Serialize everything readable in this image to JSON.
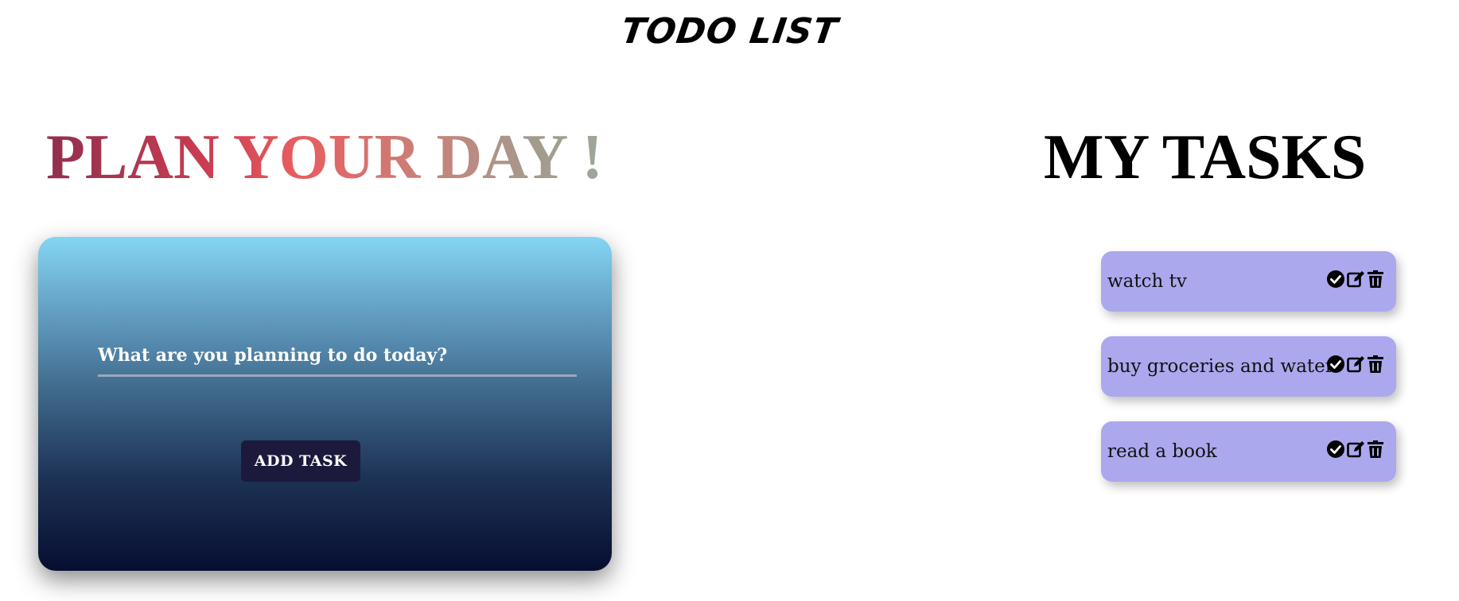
{
  "app": {
    "title": "TODO LIST"
  },
  "planner": {
    "heading": "PLAN YOUR DAY !",
    "input_placeholder": "What are you planning to do today?",
    "add_button_label": "ADD TASK"
  },
  "tasks": {
    "heading": "MY TASKS",
    "items": [
      {
        "text": "watch tv"
      },
      {
        "text": "buy groceries and water"
      },
      {
        "text": "read a book"
      }
    ],
    "action_icons": [
      "check-circle-icon",
      "edit-icon",
      "trash-icon"
    ]
  },
  "colors": {
    "task_background": "#aba8ee",
    "button_background": "#1b1a3c",
    "card_gradient_top": "#84d5f3",
    "card_gradient_bottom": "#060e30"
  }
}
